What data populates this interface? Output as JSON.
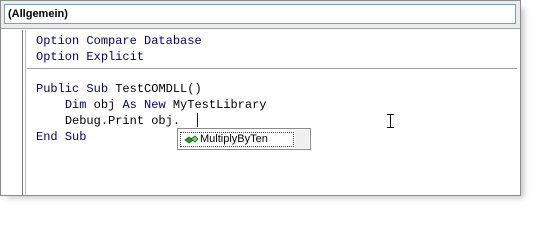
{
  "header": {
    "procedure_combo": "(Allgemein)"
  },
  "code": {
    "option_keyword_1": "Option",
    "option_rest_1": "Compare Database",
    "option_keyword_2": "Option",
    "option_rest_2": "Explicit",
    "public_kw": "Public",
    "sub_kw": "Sub",
    "sub_name": "TestCOMDLL()",
    "dim_kw": "Dim",
    "dim_var": "obj",
    "as_kw": "As",
    "new_kw": "New",
    "dim_type": "MyTestLibrary",
    "debug_line": "Debug.Print obj.",
    "end_kw": "End",
    "end_sub_kw": "Sub"
  },
  "intellisense": {
    "item_label": "MultiplyByTen",
    "item_icon": "method-icon"
  },
  "colors": {
    "keyword": "#00007f",
    "text": "#000000"
  }
}
